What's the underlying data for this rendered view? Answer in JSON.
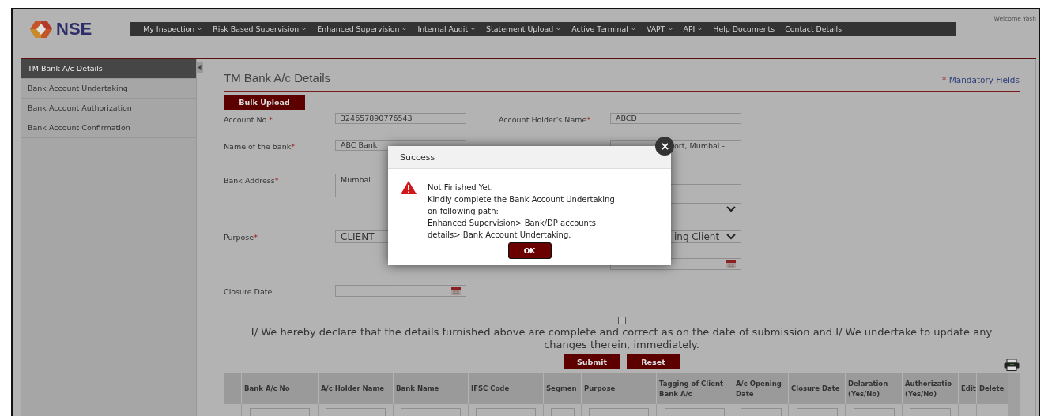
{
  "header": {
    "logo": "NSE",
    "welcome": "Welcome Yash"
  },
  "nav": [
    {
      "label": "My Inspection",
      "dropdown": true
    },
    {
      "label": "Risk Based Supervision",
      "dropdown": true
    },
    {
      "label": "Enhanced Supervision",
      "dropdown": true
    },
    {
      "label": "Internal Audit",
      "dropdown": true
    },
    {
      "label": "Statement Upload",
      "dropdown": true
    },
    {
      "label": "Active Terminal",
      "dropdown": true
    },
    {
      "label": "VAPT",
      "dropdown": true
    },
    {
      "label": "API",
      "dropdown": true
    },
    {
      "label": "Help Documents",
      "dropdown": false
    },
    {
      "label": "Contact Details",
      "dropdown": false
    }
  ],
  "sidebar": {
    "items": [
      {
        "label": "TM Bank A/c Details",
        "selected": true
      },
      {
        "label": "Bank Account Undertaking",
        "selected": false
      },
      {
        "label": "Bank Account Authorization",
        "selected": false
      },
      {
        "label": "Bank Account Confirmation",
        "selected": false
      }
    ]
  },
  "form": {
    "title": "TM Bank A/c Details",
    "mandatory_mark": "*",
    "mandatory_note": "Mandatory Fields",
    "bulk_upload": "Bulk Upload",
    "rows": [
      {
        "left": {
          "label": "Account No.",
          "required_mark": "*",
          "kind": "input",
          "value": "324657890776543"
        },
        "right": {
          "label": "Account Holder's Name",
          "required_mark": "*",
          "kind": "input",
          "value": "ABCD"
        }
      },
      {
        "left": {
          "label": "Name of the bank",
          "required_mark": "*",
          "kind": "input",
          "value": "ABC Bank"
        },
        "right": {
          "kind": "textarea",
          "value": "ort, Mumbai -",
          "covered": true
        }
      },
      {
        "left": {
          "label": "Bank Address",
          "required_mark": "*",
          "kind": "textarea",
          "value": "Mumbai"
        },
        "right": {
          "kind": "input"
        }
      },
      {
        "right": {
          "kind": "select"
        }
      },
      {
        "left": {
          "label": "Purpose",
          "required_mark": "*",
          "kind": "select",
          "value": "CLIENT"
        },
        "right": {
          "kind": "select",
          "value": "ing Client",
          "covered": true
        }
      },
      {
        "right": {
          "kind": "date"
        }
      },
      {
        "left": {
          "label": "Closure Date",
          "kind": "date"
        }
      }
    ],
    "declaration": {
      "checked": false,
      "text": "I/ We hereby declare that the details furnished above are complete and correct as on the date of submission and I/ We undertake to update any changes therein, immediately."
    },
    "buttons": [
      "Submit",
      "Reset"
    ]
  },
  "table": {
    "columns": [
      "",
      "Bank A/c No",
      "A/c Holder Name",
      "Bank Name",
      "IFSC Code",
      "Segmen",
      "Purpose",
      "Tagging of Client Bank A/c",
      "A/c Opening Date",
      "Closure Date",
      "Delaration (Yes/No)",
      "Authorizatio (Yes/No)",
      "Edit",
      "Delete"
    ]
  },
  "dialog": {
    "title": "Success",
    "lines": [
      "Not Finished Yet.",
      "Kindly complete the Bank Account Undertaking",
      "on following path:",
      "Enhanced Supervision> Bank/DP accounts",
      "details> Bank Account Undertaking."
    ],
    "ok": "OK"
  }
}
